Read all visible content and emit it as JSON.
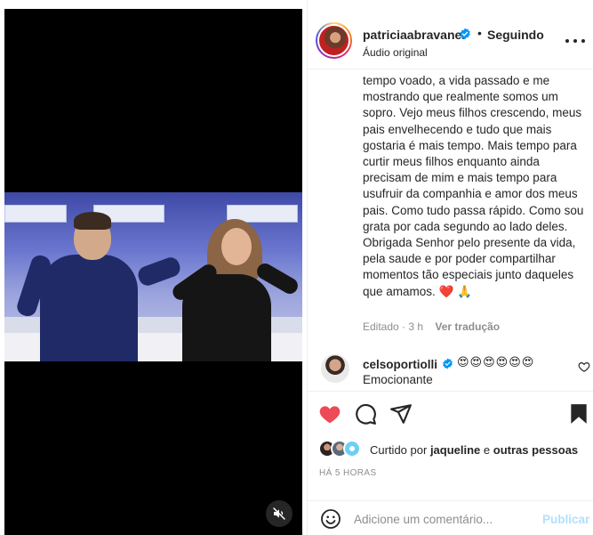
{
  "post": {
    "username": "patriciaabravanel",
    "separator": "•",
    "follow_state": "Seguindo",
    "audio": "Áudio original",
    "caption": "tempo voado, a vida passado e me mostrando que realmente somos um sopro. Vejo meus filhos crescendo, meus pais envelhecendo e tudo que mais gostaria é mais tempo. Mais tempo para curtir meus filhos enquanto ainda precisam de mim e mais tempo para usufruir da companhia e amor dos meus pais. Como tudo passa rápido. Como sou grata por cada segundo ao lado deles. Obrigada Senhor pelo presente da vida, pela saude e por poder compartilhar momentos tão especiais junto daqueles que amamos. ❤️ 🙏",
    "edited": "Editado · 3 h",
    "translate": "Ver tradução"
  },
  "comment": {
    "username": "celsoportiolli",
    "emojis": "😍😍😍😍😍😍",
    "text": "Emocionante"
  },
  "likes": {
    "prefix": "Curtido por",
    "user": "jaqueline",
    "middle": "e",
    "rest": "outras pessoas"
  },
  "time_ago": "HÁ 5 HORAS",
  "add_comment": {
    "placeholder": "Adicione um comentário...",
    "publish": "Publicar"
  },
  "icons": {
    "verified": "verified-badge-icon",
    "more": "more-options-icon",
    "mute": "muted-speaker-icon",
    "like": "heart-icon",
    "comment": "comment-bubble-icon",
    "share": "paper-plane-icon",
    "save": "bookmark-icon",
    "emoji": "smiley-icon"
  },
  "colors": {
    "like_red": "#ed4956",
    "verified_blue": "#0095f6",
    "publish_disabled": "#b2dffc",
    "muted_text": "#8e8e8e"
  }
}
